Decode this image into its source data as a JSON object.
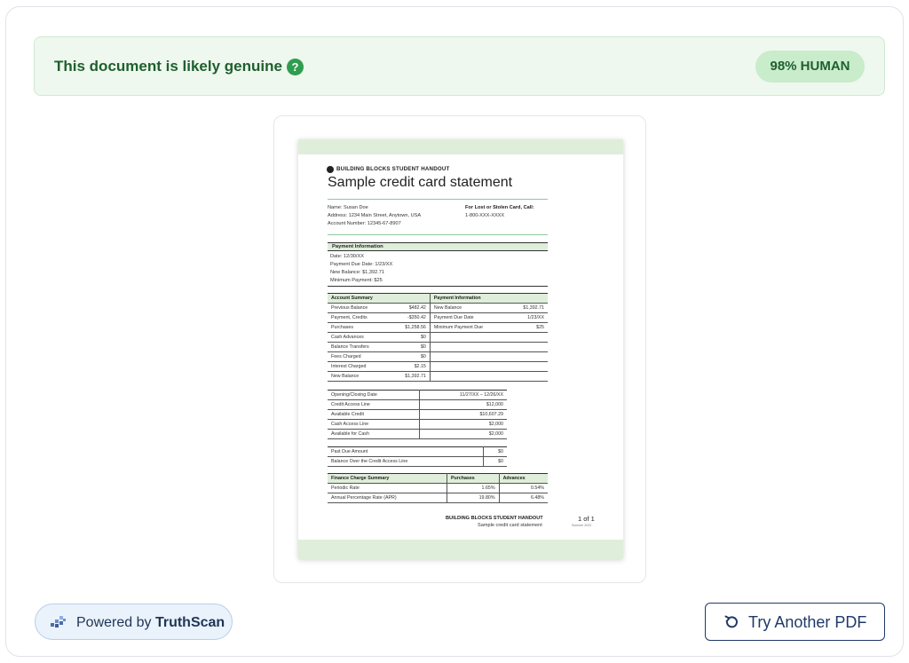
{
  "banner": {
    "message": "This document is likely genuine",
    "help_icon": "question-circle-icon",
    "badge": "98% HUMAN"
  },
  "document": {
    "org": "BUILDING BLOCKS STUDENT HANDOUT",
    "title": "Sample credit card statement",
    "customer": {
      "name": "Name: Susan Doe",
      "address": "Address: 1234 Main Street, Anytown, USA",
      "account": "Account Number: 12345-67-8907"
    },
    "lost_card_label": "For Lost or Stolen Card, Call:",
    "lost_card_phone": "1-800-XXX-XXXX",
    "payment_info_head": "Payment Information",
    "payment_info_lines": [
      "Date: 12/30/XX",
      "Payment Due Date: 1/23/XX",
      "New Balance: $1,392.71",
      "Minimum Payment: $25"
    ],
    "account_summary": {
      "head": "Account Summary",
      "rows": [
        [
          "Previous Balance",
          "$482.42"
        ],
        [
          "Payment, Credits",
          "-$350.42"
        ],
        [
          "Purchases",
          "$1,258.56"
        ],
        [
          "Cash Advances",
          "$0"
        ],
        [
          "Balance Transfers",
          "$0"
        ],
        [
          "Fees Charged",
          "$0"
        ],
        [
          "Interest Charged",
          "$2.15"
        ],
        [
          "New Balance",
          "$1,392.71"
        ]
      ]
    },
    "payment_information": {
      "head": "Payment Information",
      "rows": [
        [
          "New Balance",
          "$1,392.71"
        ],
        [
          "Payment Due Date",
          "1/23/XX"
        ],
        [
          "Minimum Payment Due",
          "$25"
        ]
      ]
    },
    "credit_table": [
      [
        "Opening/Closing Date",
        "11/27/XX – 12/26/XX"
      ],
      [
        "Credit Access Line",
        "$12,000"
      ],
      [
        "Available Credit",
        "$10,607.29"
      ],
      [
        "Cash Access Line",
        "$2,000"
      ],
      [
        "Available for Cash",
        "$2,000"
      ]
    ],
    "past_due_table": [
      [
        "Past Due Amount",
        "$0"
      ],
      [
        "Balance Over the Credit Access Line",
        "$0"
      ]
    ],
    "finance": {
      "head": [
        "Finance Charge Summary",
        "Purchases",
        "Advances"
      ],
      "rows": [
        [
          "Periodic Rate",
          "1.65%",
          "0.54%"
        ],
        [
          "Annual Percentage Rate (APR)",
          "19.80%",
          "6.48%"
        ]
      ]
    },
    "footer_org": "BUILDING BLOCKS STUDENT HANDOUT",
    "footer_sub": "Sample credit card statement",
    "page_no": "1 of 1",
    "page_small": "Summer 2023"
  },
  "footer": {
    "powered_prefix": "Powered by",
    "powered_brand": "TruthScan",
    "powered_icon": "truthscan-logo-icon",
    "try_label": "Try Another PDF",
    "try_icon": "rotate-ccw-icon"
  }
}
